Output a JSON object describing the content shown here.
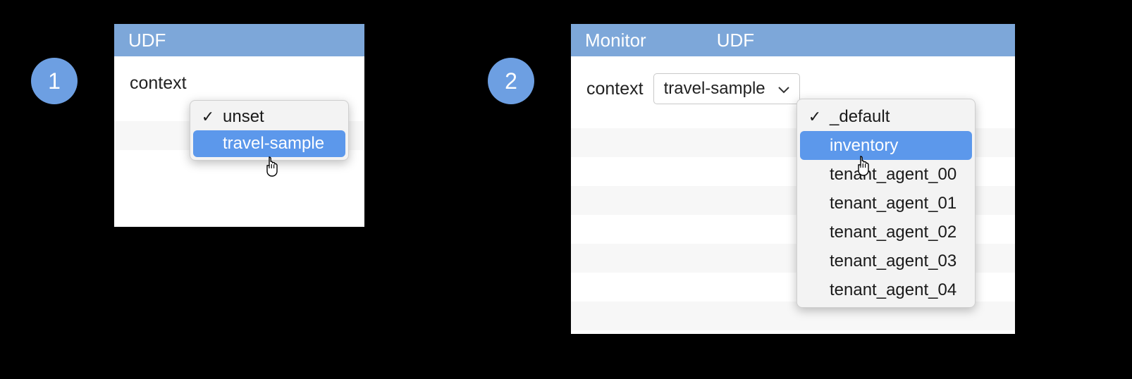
{
  "step1": {
    "badge": "1",
    "header": {
      "udf": "UDF"
    },
    "context_label": "context",
    "dropdown": {
      "items": [
        {
          "label": "unset",
          "checked": true,
          "highlighted": false
        },
        {
          "label": "travel-sample",
          "checked": false,
          "highlighted": true
        }
      ]
    }
  },
  "step2": {
    "badge": "2",
    "header": {
      "monitor": "Monitor",
      "udf": "UDF"
    },
    "context_label": "context",
    "select_value": "travel-sample",
    "dropdown": {
      "items": [
        {
          "label": "_default",
          "checked": true,
          "highlighted": false
        },
        {
          "label": "inventory",
          "checked": false,
          "highlighted": true
        },
        {
          "label": "tenant_agent_00",
          "checked": false,
          "highlighted": false
        },
        {
          "label": "tenant_agent_01",
          "checked": false,
          "highlighted": false
        },
        {
          "label": "tenant_agent_02",
          "checked": false,
          "highlighted": false
        },
        {
          "label": "tenant_agent_03",
          "checked": false,
          "highlighted": false
        },
        {
          "label": "tenant_agent_04",
          "checked": false,
          "highlighted": false
        }
      ]
    }
  }
}
